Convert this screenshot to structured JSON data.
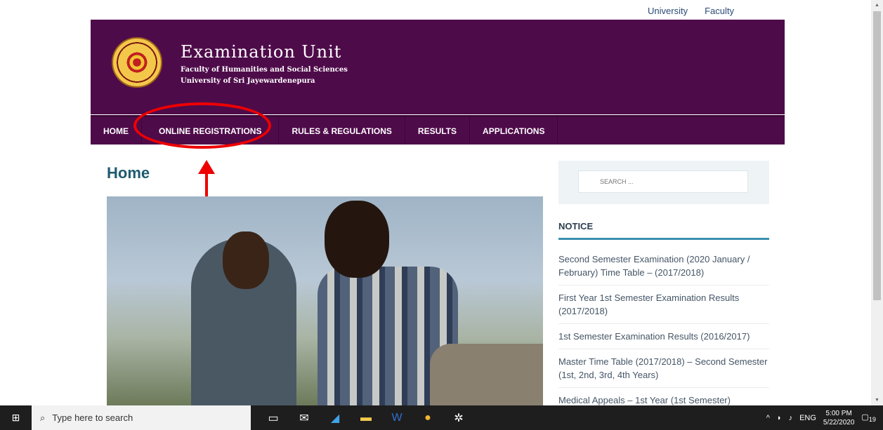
{
  "top_links": [
    "University",
    "Faculty"
  ],
  "header": {
    "title": "Examination Unit",
    "subtitle1": "Faculty of Humanities and Social Sciences",
    "subtitle2": "University of Sri Jayewardenepura"
  },
  "nav": [
    "HOME",
    "ONLINE REGISTRATIONS",
    "RULES & REGULATIONS",
    "RESULTS",
    "APPLICATIONS"
  ],
  "page_title": "Home",
  "sidebar": {
    "search_placeholder": "SEARCH ...",
    "notice_heading": "NOTICE",
    "notices": [
      "Second Semester Examination (2020 January / February) Time Table – (2017/2018)",
      "First Year 1st Semester Examination Results (2017/2018)",
      "1st Semester Examination Results (2016/2017)",
      "Master Time Table (2017/2018) – Second Semester (1st, 2nd, 3rd, 4th Years)",
      "Medical Appeals – 1st Year (1st Semester)"
    ]
  },
  "taskbar": {
    "search_placeholder": "Type here to search",
    "language": "ENG",
    "time": "5:00 PM",
    "date": "5/22/2020",
    "notification_count": "19"
  },
  "colors": {
    "header_bg": "#4e0b4a",
    "accent_blue": "#3b8fb1",
    "annotation_red": "#e00000"
  },
  "icons": [
    "windows-start-icon",
    "search-icon",
    "task-view-icon",
    "mail-icon",
    "edge-icon",
    "file-explorer-icon",
    "word-icon",
    "chrome-icon",
    "settings-icon",
    "notification-icon"
  ]
}
